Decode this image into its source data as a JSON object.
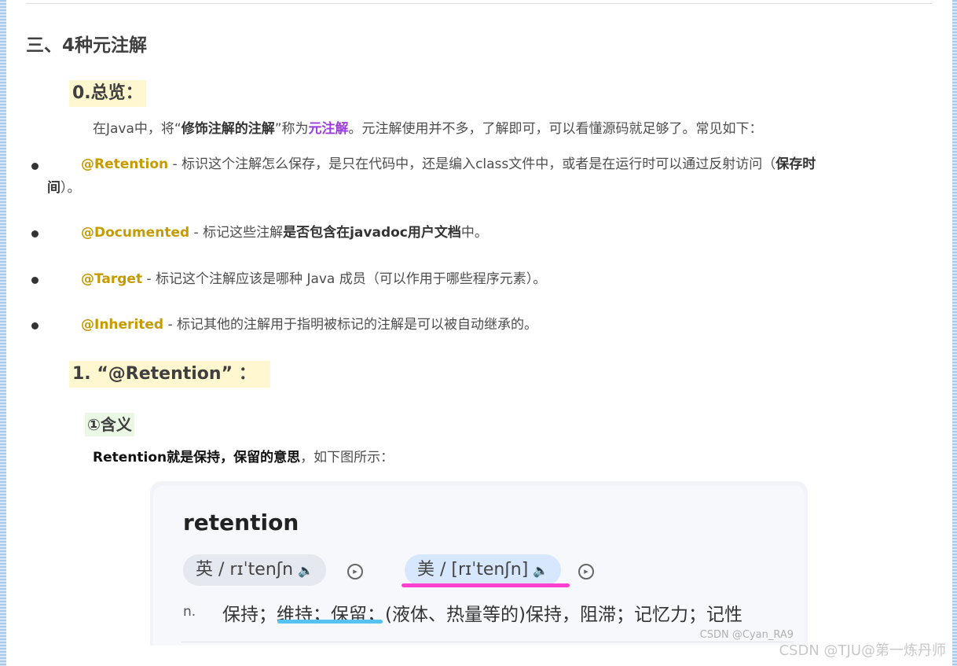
{
  "section_title": "三、4种元注解",
  "overview": {
    "heading": "0.总览：",
    "intro_prefix": "在Java中，将“",
    "intro_bold": "修饰注解的注解",
    "intro_mid": "”称为",
    "intro_term": "元注解",
    "intro_suffix": "。元注解使用并不多，了解即可，可以看懂源码就足够了。常见如下："
  },
  "annotations": [
    {
      "tag": "@Retention",
      "text_line1": " - 标识这个注解怎么保存，是只在代码中，还是编入class文件中，或者是在运行时可以通过反射访问（",
      "bold1": "保存时",
      "bold2": "间",
      "text_line2": "）。"
    },
    {
      "tag": "@Documented",
      "text": " - 标记这些注解",
      "bold": "是否包含在javadoc用户文档",
      "text_after": "中。"
    },
    {
      "tag": "@Target",
      "text": " - 标记这个注解应该是哪种 Java 成员（可以作用于哪些程序元素）。"
    },
    {
      "tag": "@Inherited",
      "text": " - 标记其他的注解用于指明被标记的注解是可以被自动继承的。"
    }
  ],
  "retention_section": {
    "heading": "1. “@Retention” ：",
    "sub_heading": "①含义",
    "desc_bold": "Retention就是保持，保留的意思",
    "desc_rest": "，如下图所示："
  },
  "dictionary": {
    "word": "retention",
    "uk_phonetic": "英 / rɪˈtenʃn",
    "us_phonetic": "美 / [rɪˈtenʃn]",
    "part_of_speech": "n.",
    "definition": "保持；维持；保留；(液体、热量等的)保持，阻滞；记忆力；记性",
    "watermark": "CSDN @Cyan_RA9"
  },
  "page_watermark": "CSDN @TJU@第一炼丹师",
  "colors": {
    "tag": "#c69b00",
    "term": "#9a3ce0",
    "us_underline": "#ff3fd0",
    "def_underline": "#55c3f0"
  }
}
